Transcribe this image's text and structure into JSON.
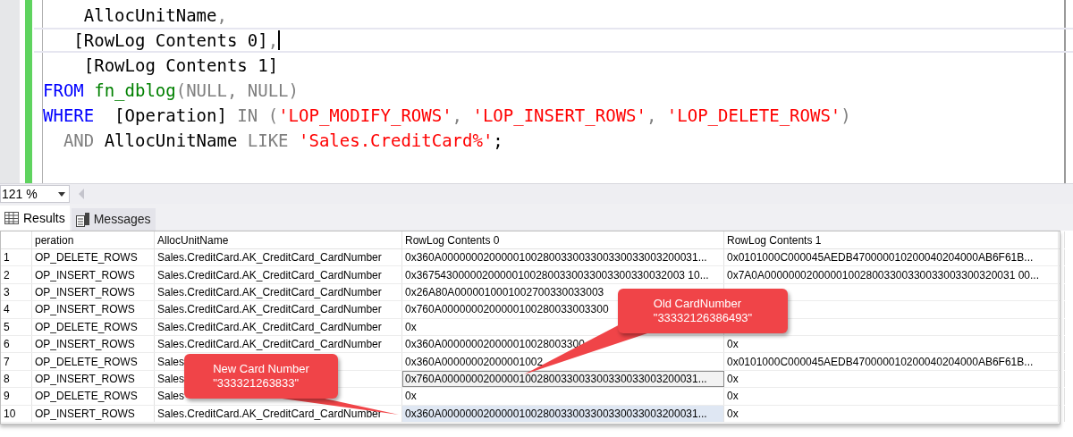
{
  "editor": {
    "lines": [
      {
        "highlighted": false,
        "tokens": [
          {
            "kind": "plain",
            "text": "    AllocUnitName"
          },
          {
            "kind": "punct",
            "text": ","
          }
        ]
      },
      {
        "highlighted": true,
        "tokens": [
          {
            "kind": "plain",
            "text": "   [RowLog Contents 0]"
          },
          {
            "kind": "punct",
            "text": ","
          }
        ]
      },
      {
        "highlighted": false,
        "tokens": [
          {
            "kind": "plain",
            "text": "    [RowLog Contents 1]"
          }
        ]
      },
      {
        "highlighted": false,
        "tokens": [
          {
            "kind": "keyword",
            "text": "FROM"
          },
          {
            "kind": "function",
            "text": " fn_dblog"
          },
          {
            "kind": "punct",
            "text": "(NULL, NULL)"
          }
        ]
      },
      {
        "highlighted": false,
        "tokens": [
          {
            "kind": "keyword",
            "text": "WHERE"
          },
          {
            "kind": "plain",
            "text": "  [Operation] "
          },
          {
            "kind": "punct",
            "text": "IN ("
          },
          {
            "kind": "string",
            "text": "'LOP_MODIFY_ROWS'"
          },
          {
            "kind": "punct",
            "text": ", "
          },
          {
            "kind": "string",
            "text": "'LOP_INSERT_ROWS'"
          },
          {
            "kind": "punct",
            "text": ", "
          },
          {
            "kind": "string",
            "text": "'LOP_DELETE_ROWS'"
          },
          {
            "kind": "punct",
            "text": ")"
          }
        ]
      },
      {
        "highlighted": false,
        "tokens": [
          {
            "kind": "punct",
            "text": "  AND"
          },
          {
            "kind": "plain",
            "text": " AllocUnitName "
          },
          {
            "kind": "punct",
            "text": "LIKE"
          },
          {
            "kind": "string",
            "text": " 'Sales.CreditCard%'"
          },
          {
            "kind": "plain",
            "text": ";"
          }
        ]
      }
    ]
  },
  "zoom": {
    "value": "121 %"
  },
  "tabs": [
    {
      "label": "Results",
      "kind": "grid",
      "selected": true
    },
    {
      "label": "Messages",
      "kind": "messages",
      "selected": false
    }
  ],
  "grid": {
    "columns": [
      "peration",
      "AllocUnitName",
      "RowLog Contents 0",
      "RowLog Contents 1"
    ],
    "rows": [
      {
        "number": "1",
        "selected": false,
        "focused": false,
        "cells": [
          "OP_DELETE_ROWS",
          "Sales.CreditCard.AK_CreditCard_CardNumber",
          "0x360A0000000200000100280033003300330033003200031...",
          "0x0101000C000045AEDB470000010200040204000AB6F61B..."
        ]
      },
      {
        "number": "2",
        "selected": false,
        "focused": false,
        "cells": [
          "OP_INSERT_ROWS",
          "Sales.CreditCard.AK_CreditCard_CardNumber",
          "0x367543000002000001002800330033003300330032003 10...",
          "0x7A0A000000020000010028003300330033003300320031 00..."
        ]
      },
      {
        "number": "3",
        "selected": false,
        "focused": false,
        "cells": [
          "OP_INSERT_ROWS",
          "Sales.CreditCard.AK_CreditCard_CardNumber",
          "0x26A80A0000010001002700330033003",
          ""
        ]
      },
      {
        "number": "4",
        "selected": false,
        "focused": false,
        "cells": [
          "OP_INSERT_ROWS",
          "Sales.CreditCard.AK_CreditCard_CardNumber",
          "0x760A0000000200000100280033003300",
          ""
        ]
      },
      {
        "number": "5",
        "selected": false,
        "focused": false,
        "cells": [
          "OP_DELETE_ROWS",
          "Sales.CreditCard.AK_CreditCard_CardNumber",
          "0x",
          ""
        ]
      },
      {
        "number": "6",
        "selected": false,
        "focused": false,
        "cells": [
          "OP_INSERT_ROWS",
          "Sales.CreditCard.AK_CreditCard_CardNumber",
          "0x360A000000020000010028003300",
          "0x"
        ]
      },
      {
        "number": "7",
        "selected": false,
        "focused": false,
        "cells": [
          "OP_DELETE_ROWS",
          "Sales",
          "0x360A00000002000001002",
          "0x0101000C000045AEDB470000010200040204000AB6F61B..."
        ]
      },
      {
        "number": "8",
        "selected": false,
        "focused": true,
        "cells": [
          "OP_INSERT_ROWS",
          "Sales",
          "0x760A0000000200000100280033003300330033003200031...",
          "0x"
        ]
      },
      {
        "number": "9",
        "selected": false,
        "focused": false,
        "cells": [
          "OP_DELETE_ROWS",
          "Sales",
          "0x",
          "0x"
        ]
      },
      {
        "number": "10",
        "selected": true,
        "focused": false,
        "cells": [
          "OP_INSERT_ROWS",
          "Sales.CreditCard.AK_CreditCard_CardNumber",
          "0x360A0000000200000100280033003300330033003200031...",
          "0x"
        ]
      }
    ]
  },
  "callouts": [
    {
      "lines": [
        "Old CardNumber",
        "\"33332126386493\""
      ]
    },
    {
      "lines": [
        "New Card Number",
        "\"333321263833\""
      ]
    }
  ]
}
